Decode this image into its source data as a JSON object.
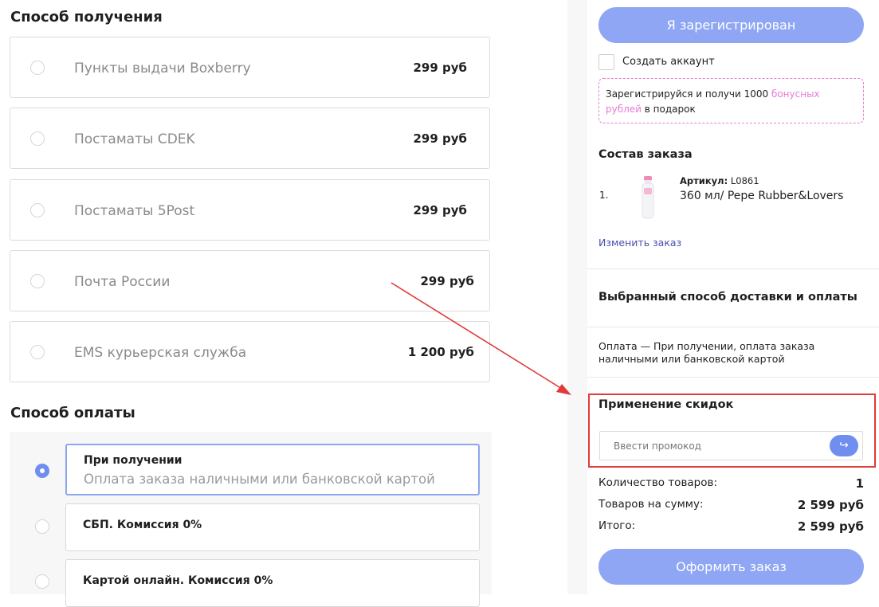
{
  "delivery": {
    "title": "Способ получения",
    "options": [
      {
        "name": "Пункты выдачи Boxberry",
        "price": "299 руб"
      },
      {
        "name": "Постаматы CDEK",
        "price": "299 руб"
      },
      {
        "name": "Постаматы 5Post",
        "price": "299 руб"
      },
      {
        "name": "Почта России",
        "price": "299 руб"
      },
      {
        "name": "EMS курьерская служба",
        "price": "1 200 руб"
      }
    ]
  },
  "payment": {
    "title": "Способ оплаты",
    "options": [
      {
        "title": "При получении",
        "subtitle": "Оплата заказа наличными или банковской картой",
        "selected": true
      },
      {
        "title": "СБП. Комиссия 0%",
        "selected": false
      },
      {
        "title": "Картой онлайн. Комиссия 0%",
        "selected": false
      }
    ]
  },
  "sidebar": {
    "registered_button": "Я зарегистрирован",
    "create_account_label": "Создать аккаунт",
    "promo_note": {
      "before": "Зарегистрируйся и получи 1000 ",
      "highlight": "бонусных рублей",
      "after": " в подарок"
    },
    "order_title": "Состав заказа",
    "item": {
      "number": "1.",
      "article_label": "Артикул:",
      "article_value": "L0861",
      "name": "360 мл/ Pepe Rubber&Lovers"
    },
    "change_order_link": "Изменить заказ",
    "delivery_payment_title": "Выбранный способ доставки и оплаты",
    "payment_summary": "Оплата — При получении, оплата заказа наличными или банковской картой",
    "discount_title": "Применение скидок",
    "promo_placeholder": "Ввести промокод",
    "promo_apply_icon": "arrow-right-icon",
    "summary": [
      {
        "label": "Количество товаров:",
        "value": "1"
      },
      {
        "label": "Товаров на сумму:",
        "value": "2 599 руб"
      },
      {
        "label": "Итого:",
        "value": "2 599 руб"
      }
    ],
    "checkout_button": "Оформить заказ"
  },
  "colors": {
    "accent": "#8ea6f3",
    "radio_selected": "#6f8ef0",
    "highlight_pink": "#e87bd5",
    "annotation_red": "#e03a3a"
  }
}
